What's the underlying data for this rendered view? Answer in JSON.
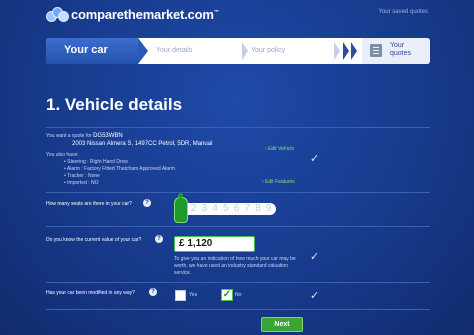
{
  "header": {
    "logo_text": "comparethemarket",
    "logo_suffix": ".com",
    "saved_quotes_link": "Your saved quotes"
  },
  "steps": [
    {
      "label": "Your car",
      "state": "active"
    },
    {
      "label": "Your details",
      "state": "upcoming"
    },
    {
      "label": "Your policy",
      "state": "upcoming"
    },
    {
      "label": "Your quotes",
      "state": "final"
    }
  ],
  "page_title": "1. Vehicle details",
  "vehicle": {
    "quote_intro": "You want a quote for",
    "registration": "DG53WBN",
    "description": "2003 Nissan Almera S, 1497CC Petrol, 5DR, Manual",
    "edit_vehicle": "Edit Vehicle",
    "also_have": "You also have:",
    "features": [
      "Steering : Right Hand Drive",
      "Alarm : Factory Fitted Thatcham Approved Alarm",
      "Tracker : None",
      "Imported : NO"
    ],
    "edit_features": "Edit Features"
  },
  "seats": {
    "question": "How many seats are there in your car?",
    "options": "1 2 3 4 5 6 7 8 9",
    "selected": 1
  },
  "value": {
    "question": "Do you know the current value of your car?",
    "currency": "£",
    "amount": "1,120",
    "hint": "To give you an indication of how much your car may be worth, we have used an industry standard valuation service."
  },
  "modified": {
    "question": "Has your car been modified in any way?",
    "yes_label": "Yes",
    "no_label": "No",
    "selected": "No"
  },
  "next_button": "Next",
  "colors": {
    "accent": "#3aa534",
    "background": "#173a8c"
  }
}
